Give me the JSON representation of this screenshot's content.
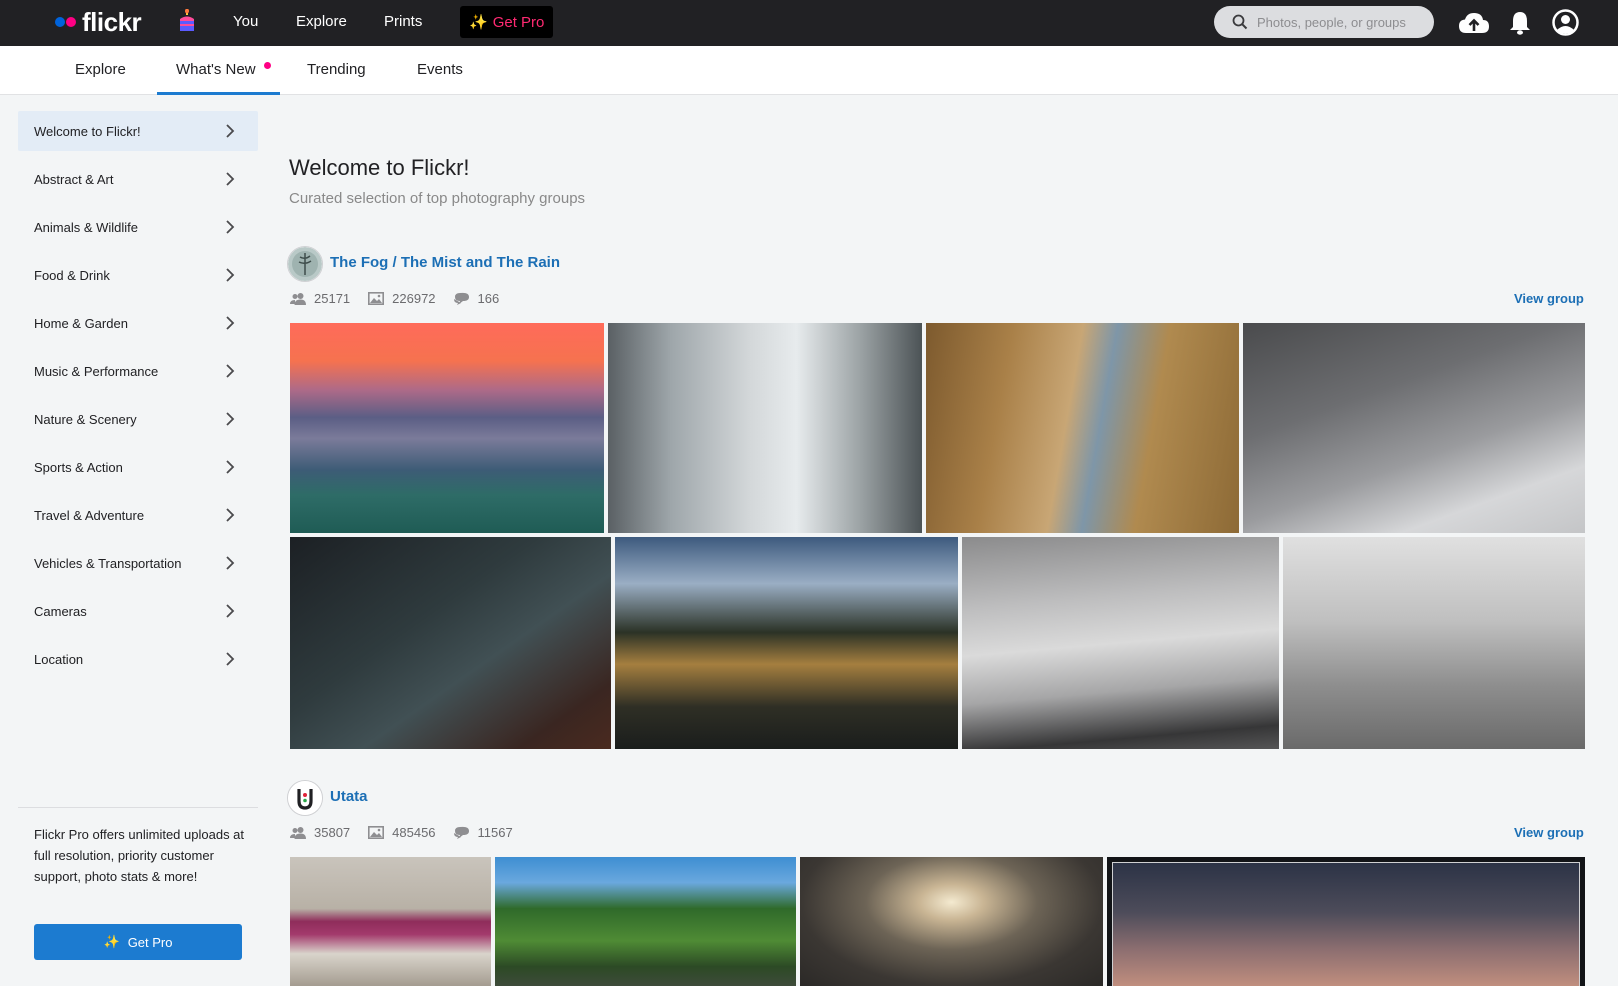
{
  "topnav": {
    "logo_text": "flickr",
    "links": [
      "You",
      "Explore",
      "Prints"
    ],
    "get_pro_label": "Get Pro",
    "search_placeholder": "Photos, people, or groups"
  },
  "subnav": {
    "tabs": [
      "Explore",
      "What's New",
      "Trending",
      "Events"
    ],
    "active_tab": "What's New"
  },
  "sidebar": {
    "items": [
      "Welcome to Flickr!",
      "Abstract & Art",
      "Animals & Wildlife",
      "Food & Drink",
      "Home & Garden",
      "Music & Performance",
      "Nature & Scenery",
      "Sports & Action",
      "Travel & Adventure",
      "Vehicles & Transportation",
      "Cameras",
      "Location"
    ],
    "active_item": "Welcome to Flickr!",
    "pro_text": "Flickr Pro offers unlimited uploads at full resolution, priority customer support, photo stats & more!",
    "pro_button_label": "Get Pro"
  },
  "main": {
    "title": "Welcome to Flickr!",
    "subtitle": "Curated selection of top photography groups",
    "groups": [
      {
        "name": "The Fog / The Mist and The Rain",
        "members": "25171",
        "photos": "226972",
        "discussions": "166",
        "view_label": "View group"
      },
      {
        "name": "Utata",
        "members": "35807",
        "photos": "485456",
        "discussions": "11567",
        "view_label": "View group"
      }
    ]
  },
  "colors": {
    "topbar": "#212124",
    "link_blue": "#1c6fb5",
    "accent_blue": "#1c7bd0",
    "pink": "#ff0084",
    "pro_pink": "#ff2a72"
  }
}
